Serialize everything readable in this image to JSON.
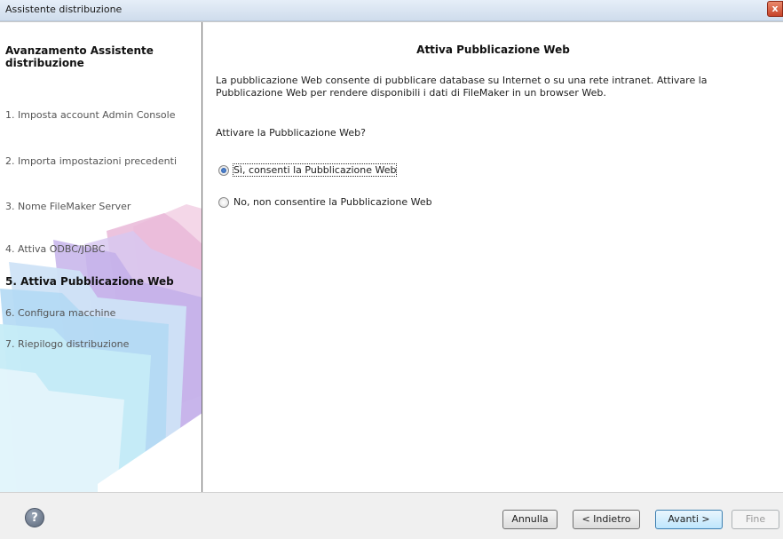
{
  "window": {
    "title": "Assistente distribuzione",
    "close_label": "x"
  },
  "sidebar": {
    "title": "Avanzamento Assistente distribuzione",
    "steps": [
      {
        "label": "1. Imposta account Admin Console"
      },
      {
        "label": "2. Importa impostazioni precedenti"
      },
      {
        "label": "3. Nome FileMaker Server"
      },
      {
        "label": "4. Attiva ODBC/JDBC"
      },
      {
        "label": "5. Attiva Pubblicazione Web",
        "active": true
      },
      {
        "label": "6. Configura macchine"
      },
      {
        "label": "7. Riepilogo distribuzione"
      }
    ]
  },
  "main": {
    "title": "Attiva Pubblicazione Web",
    "description": "La pubblicazione Web consente di pubblicare database su Internet o su una rete intranet. Attivare la Pubblicazione Web per rendere disponibili i dati di FileMaker in un browser Web.",
    "question": "Attivare la Pubblicazione Web?",
    "options": [
      {
        "label": "Sì, consenti la Pubblicazione Web",
        "selected": true
      },
      {
        "label": "No, non consentire la Pubblicazione Web",
        "selected": false
      }
    ]
  },
  "footer": {
    "help_label": "?",
    "cancel_label": "Annulla",
    "back_label": "< Indietro",
    "next_label": "Avanti >",
    "finish_label": "Fine"
  },
  "colors": {
    "accent": "#3c7fb1",
    "folder_pink": "#f3c6dd",
    "folder_purple": "#c9b8ea",
    "folder_blue": "#a9d4f2",
    "folder_cyan": "#bfe8f5"
  }
}
